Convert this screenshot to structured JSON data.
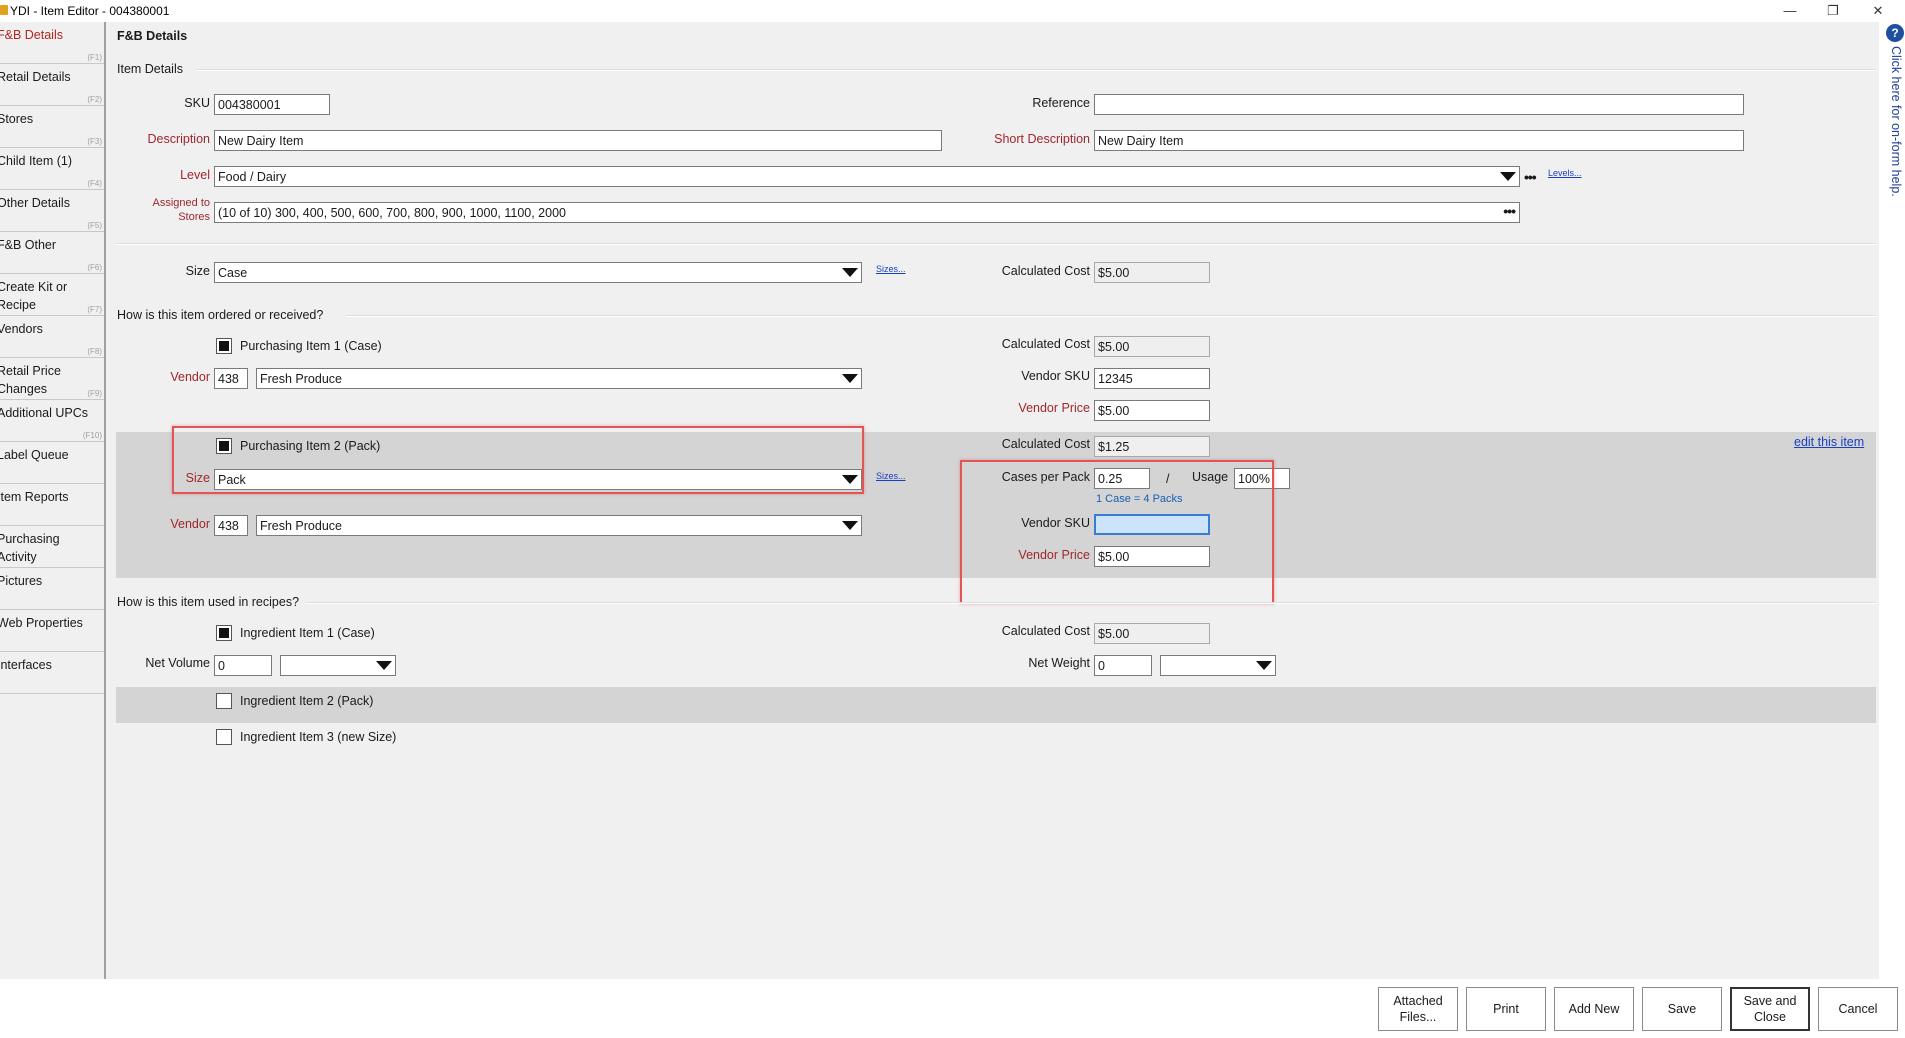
{
  "window": {
    "title": "YDI - Item Editor - 004380001",
    "minimize": "—",
    "restore": "❐",
    "close": "✕"
  },
  "sidebar": {
    "items": [
      {
        "label": "F&B Details",
        "key": "(F1)"
      },
      {
        "label": "Retail Details",
        "key": "(F2)"
      },
      {
        "label": "Stores",
        "key": "(F3)"
      },
      {
        "label": "Child Item (1)",
        "key": "(F4)"
      },
      {
        "label": "Other Details",
        "key": "(F5)"
      },
      {
        "label": "F&B Other",
        "key": "(F6)"
      },
      {
        "label": "Create Kit or Recipe",
        "key": "(F7)"
      },
      {
        "label": "Vendors",
        "key": "(F8)"
      },
      {
        "label": "Retail Price Changes",
        "key": "(F9)"
      },
      {
        "label": "Additional UPCs",
        "key": "(F10)"
      },
      {
        "label": "Label Queue",
        "key": ""
      },
      {
        "label": "Item Reports",
        "key": ""
      },
      {
        "label": "Purchasing Activity",
        "key": ""
      },
      {
        "label": "Pictures",
        "key": ""
      },
      {
        "label": "Web Properties",
        "key": ""
      },
      {
        "label": "Interfaces",
        "key": ""
      }
    ]
  },
  "main": {
    "heading": "F&B Details",
    "item_details": {
      "section": "Item Details",
      "sku_label": "SKU",
      "sku": "004380001",
      "reference_label": "Reference",
      "reference": "",
      "description_label": "Description",
      "description": "New Dairy Item",
      "short_description_label": "Short Description",
      "short_description": "New Dairy Item",
      "level_label": "Level",
      "level": "Food / Dairy",
      "levels_link": "Levels...",
      "assigned_label_1": "Assigned to",
      "assigned_label_2": "Stores",
      "assigned": "(10 of 10) 300, 400, 500, 600, 700, 800, 900, 1000, 1100, 2000",
      "size_label": "Size",
      "size": "Case",
      "sizes_link": "Sizes...",
      "calc_cost_label": "Calculated Cost",
      "calc_cost": "$5.00"
    },
    "ordering": {
      "section": "How is this item ordered or received?",
      "p1_label": "Purchasing Item 1 (Case)",
      "p1_calc_cost_label": "Calculated Cost",
      "p1_calc_cost": "$5.00",
      "p1_vendor_label": "Vendor",
      "p1_vendor_num": "438",
      "p1_vendor_name": "Fresh Produce",
      "p1_vendor_sku_label": "Vendor SKU",
      "p1_vendor_sku": "12345",
      "p1_vendor_price_label": "Vendor Price",
      "p1_vendor_price": "$5.00",
      "p2_label": "Purchasing Item 2 (Pack)",
      "p2_calc_cost_label": "Calculated Cost",
      "p2_calc_cost": "$1.25",
      "edit_link": "edit this item",
      "p2_size_label": "Size",
      "p2_size": "Pack",
      "p2_sizes_link": "Sizes...",
      "cases_per_pack_label": "Cases per Pack",
      "cases_per_pack": "0.25",
      "slash": "/",
      "usage_label": "Usage",
      "usage": "100%",
      "conversion_note": "1 Case = 4 Packs",
      "p2_vendor_label": "Vendor",
      "p2_vendor_num": "438",
      "p2_vendor_name": "Fresh Produce",
      "p2_vendor_sku_label": "Vendor SKU",
      "p2_vendor_sku": "",
      "p2_vendor_price_label": "Vendor Price",
      "p2_vendor_price": "$5.00"
    },
    "recipes": {
      "section": "How is this item used in recipes?",
      "i1_label": "Ingredient Item 1 (Case)",
      "i1_calc_cost_label": "Calculated Cost",
      "i1_calc_cost": "$5.00",
      "net_volume_label": "Net Volume",
      "net_volume": "0",
      "net_volume_unit": "",
      "net_weight_label": "Net Weight",
      "net_weight": "0",
      "net_weight_unit": "",
      "i2_label": "Ingredient Item 2 (Pack)",
      "i3_label": "Ingredient Item 3 (new Size)"
    }
  },
  "help": {
    "text": "Click here for on-form help."
  },
  "buttons": {
    "attached_1": "Attached",
    "attached_2": "Files...",
    "print": "Print",
    "add_new": "Add New",
    "save": "Save",
    "save_close_1": "Save and",
    "save_close_2": "Close",
    "cancel": "Cancel"
  },
  "colors": {
    "label_red": "#a0272d",
    "highlight_red": "#e05555",
    "link_blue": "#1a3fc0",
    "band_gray": "#d4d4d4"
  }
}
